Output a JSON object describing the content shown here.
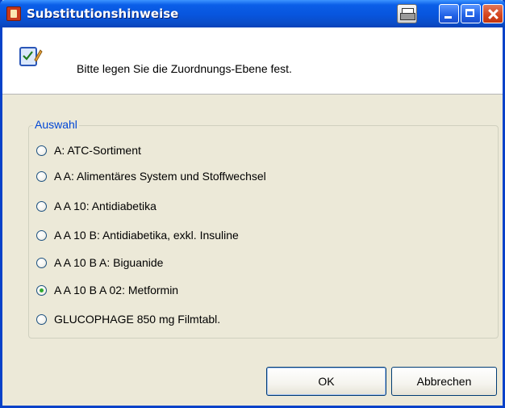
{
  "window": {
    "title": "Substitutionshinweise"
  },
  "header": {
    "message": "Bitte legen Sie die Zuordnungs-Ebene fest."
  },
  "group": {
    "legend": "Auswahl",
    "options": [
      {
        "label": "A: ATC-Sortiment",
        "selected": false
      },
      {
        "label": "A A: Alimentäres System und Stoffwechsel",
        "selected": false
      },
      {
        "label": "A A 10: Antidiabetika",
        "selected": false
      },
      {
        "label": "A A 10 B: Antidiabetika, exkl. Insuline",
        "selected": false
      },
      {
        "label": "A A 10 B A: Biguanide",
        "selected": false
      },
      {
        "label": "A A 10 B A 02: Metformin",
        "selected": true
      },
      {
        "label": "GLUCOPHAGE 850 mg Filmtabl.",
        "selected": false
      }
    ]
  },
  "buttons": {
    "ok": "OK",
    "cancel": "Abbrechen"
  },
  "colors": {
    "titlebar": "#0a5ee8",
    "legend": "#0046d5",
    "dialog_bg": "#ece9d8",
    "radio_dot": "#2fa82f"
  },
  "icons": [
    "app-icon",
    "printer-icon",
    "minimize-icon",
    "maximize-icon",
    "close-icon",
    "checklist-pen-icon"
  ]
}
